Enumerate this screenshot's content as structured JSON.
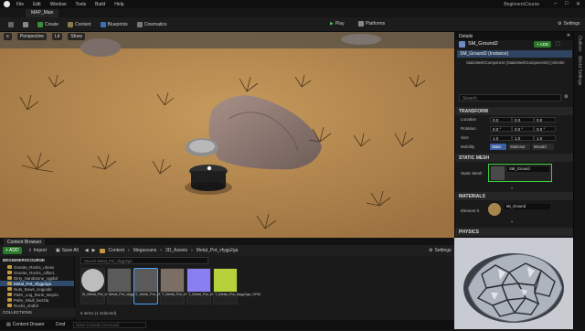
{
  "menu": {
    "items": [
      "File",
      "Edit",
      "Window",
      "Tools",
      "Build",
      "Help"
    ],
    "project": "BeginnersCourse"
  },
  "level_tab": "MAP_Main",
  "toolbar": {
    "create": "Create",
    "content": "Content",
    "blueprints": "Blueprints",
    "cinematics": "Cinematics",
    "play": "Play",
    "platforms": "Platforms",
    "settings": "Settings"
  },
  "viewport": {
    "perspective": "Perspective",
    "lit": "Lit",
    "show": "Show"
  },
  "details": {
    "tab": "Details",
    "actor": "SM_Ground2",
    "add_label": "+ ADD",
    "instance_row": "SM_Ground2 (Instance)",
    "component_row": "StaticMeshComponent (StaticMeshComponent0) (Inherite",
    "search_placeholder": "Search",
    "transform": {
      "header": "TRANSFORM",
      "location_label": "Location",
      "rotation_label": "Rotation",
      "size_label": "Size",
      "location": [
        "0.0",
        "0.0",
        "0.0"
      ],
      "rotation": [
        "0.0 °",
        "0.0 °",
        "0.0 °"
      ],
      "scale": [
        "1.0",
        "1.0",
        "1.0"
      ],
      "mobility_label": "Mobility",
      "mobility": [
        "Static",
        "Stationar",
        "Movabl"
      ]
    },
    "static_mesh": {
      "header": "STATIC MESH",
      "label": "Static Mesh",
      "value": "SM_Ground"
    },
    "materials": {
      "header": "MATERIALS",
      "label": "Element 0",
      "value": "MI_Ground"
    },
    "physics": {
      "header": "PHYSICS"
    }
  },
  "right_strip": [
    "Outliner",
    "World Settings"
  ],
  "content_browser": {
    "tab": "Content Browser",
    "add": "+ ADD",
    "import": "Import",
    "save_all": "Save All",
    "breadcrumb": [
      "Content",
      "Megascans",
      "3D_Assets",
      "Metal_Pot_vfygp2ga"
    ],
    "settings": "Settings",
    "search_placeholder": "Search Metal_Pot_vfygp2ga",
    "tree_root": "BEGINNERSCOURSE",
    "tree": [
      "Granite_Rocks_uhesv",
      "Granite_Rocks_oilfar1",
      "Dirty_Sandstone_vgpbd",
      "Metal_Pot_vfygp2ga",
      "Nuts_Bows_scqjcabi",
      "Palm_Log_Bone_twq1ts",
      "Palm_Skull_bwr2la",
      "Rocks_shdbil"
    ],
    "selected_tree_item": "Metal_Pot_vfygp2ga",
    "collections": "COLLECTIONS",
    "items_status": "6 items (1 selected)",
    "assets": [
      {
        "name": "M_Metal_Pot_vfygp2ga",
        "kind": "material"
      },
      {
        "name": "Metal_Pot_vfygp2ga_LOD0",
        "kind": "mesh"
      },
      {
        "name": "S_Metal_Pot_vfygp2ga",
        "kind": "mesh"
      },
      {
        "name": "T_Metal_Pot_vfygp2ga_D",
        "kind": "texture"
      },
      {
        "name": "T_Metal_Pot_vfygp2ga_N",
        "kind": "texture-normal"
      },
      {
        "name": "T_Metal_Pot_vfygp2ga_ORM",
        "kind": "texture-orm"
      }
    ]
  },
  "status": {
    "content_drawer": "Content Drawer",
    "cmd": "Cmd",
    "console_placeholder": "Enter Console Command"
  }
}
